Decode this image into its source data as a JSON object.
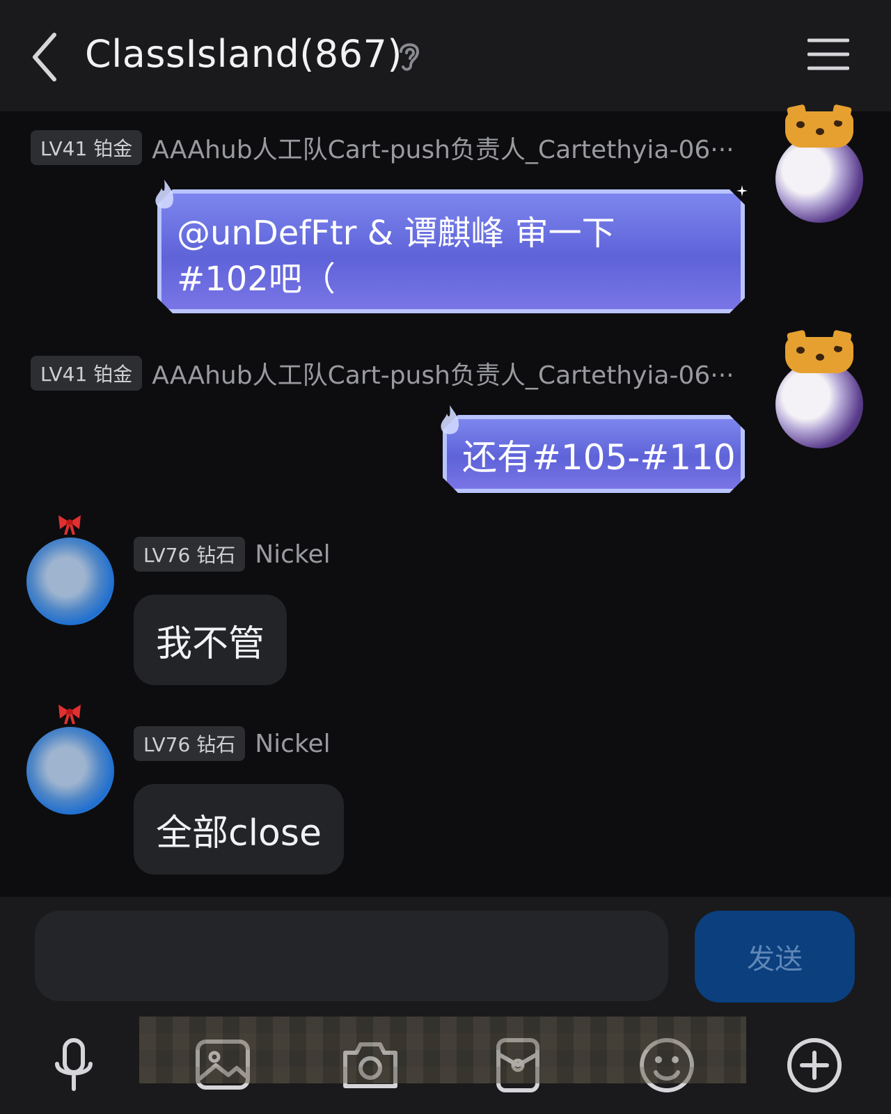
{
  "header": {
    "title": "ClassIsland(867)"
  },
  "messages": [
    {
      "badge": "LV41 铂金",
      "sender": "AAAhub人工队Cart-push负责人_Cartethyia-06···",
      "line1": "@unDefFtr & 谭麒峰 审一下",
      "line2": "#102吧（"
    },
    {
      "badge": "LV41 铂金",
      "sender": "AAAhub人工队Cart-push负责人_Cartethyia-06···",
      "text": "还有#105-#110"
    },
    {
      "badge": "LV76 钻石",
      "sender": "Nickel",
      "text": "我不管"
    },
    {
      "badge": "LV76 钻石",
      "sender": "Nickel",
      "text": "全部close"
    }
  ],
  "input": {
    "value": "",
    "send_label": "发送"
  },
  "toolbar": {
    "icons": [
      "microphone-icon",
      "image-icon",
      "camera-icon",
      "red-packet-icon",
      "emoji-icon",
      "plus-icon"
    ]
  },
  "colors": {
    "background": "#0d0d0f",
    "header": "#1a1a1c",
    "fancy_bubble": "#6a6fe0",
    "plain_bubble": "#232428",
    "send_button": "#0b3f7e"
  }
}
